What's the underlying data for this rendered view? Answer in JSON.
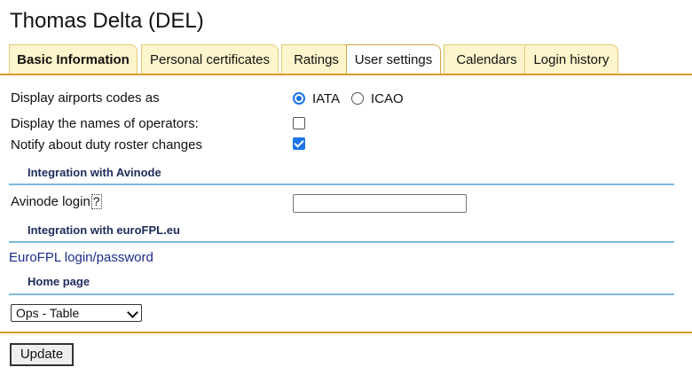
{
  "page_title": "Thomas Delta (DEL)",
  "tabs": [
    {
      "label": "Basic Information"
    },
    {
      "label": "Personal certificates"
    },
    {
      "label": "Ratings"
    },
    {
      "label": "User settings"
    },
    {
      "label": "Calendars"
    },
    {
      "label": "Login history"
    }
  ],
  "settings": {
    "airport_codes_label": "Display airports codes as",
    "airport_codes_options": [
      "IATA",
      "ICAO"
    ],
    "airport_codes_selected": "IATA",
    "operator_names_label": "Display the names of operators:",
    "operator_names_checked": false,
    "duty_roster_label": "Notify about duty roster changes",
    "duty_roster_checked": true
  },
  "avinode": {
    "section_title": "Integration with Avinode",
    "login_label": "Avinode login",
    "help_glyph": "?",
    "login_value": ""
  },
  "eurofpl": {
    "section_title": "Integration with euroFPL.eu",
    "link_text": "EuroFPL login/password"
  },
  "home_page": {
    "section_title": "Home page",
    "selected": "Ops - Table"
  },
  "update_button": "Update"
}
